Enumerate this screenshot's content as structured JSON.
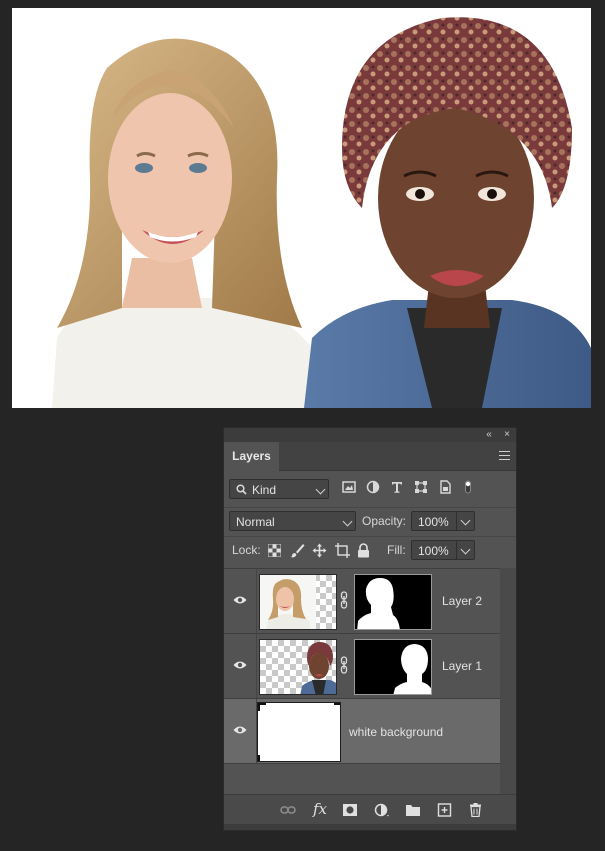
{
  "panel": {
    "collapse_glyph": "«",
    "close_glyph": "×",
    "tab_label": "Layers"
  },
  "filter": {
    "kind_label": "Kind",
    "icons": [
      "search-icon",
      "pixel-layer-filter-icon",
      "adjustment-layer-filter-icon",
      "type-layer-filter-icon",
      "shape-layer-filter-icon",
      "smart-object-filter-icon",
      "filter-toggle-icon"
    ]
  },
  "blend": {
    "mode": "Normal",
    "opacity_label": "Opacity:",
    "opacity_value": "100%"
  },
  "lock": {
    "label": "Lock:",
    "fill_label": "Fill:",
    "fill_value": "100%",
    "icons": [
      "lock-transparent-pixels-icon",
      "lock-image-pixels-icon",
      "lock-position-icon",
      "lock-artboard-icon",
      "lock-all-icon"
    ]
  },
  "layers": [
    {
      "name": "Layer 2",
      "visible": true,
      "selected": false
    },
    {
      "name": "Layer 1",
      "visible": true,
      "selected": false
    },
    {
      "name": "white background",
      "visible": true,
      "selected": true
    }
  ],
  "bottom_icons": [
    "link-layers-icon",
    "fx-icon",
    "layer-mask-icon",
    "adjustment-layer-icon",
    "group-folder-icon",
    "new-layer-icon",
    "trash-icon"
  ],
  "bottom_fx_label": "fx",
  "colors": {
    "panel_bg": "#535353",
    "app_bg": "#252525",
    "selected_row": "#6a6a6a",
    "canvas_bg": "#ffffff"
  }
}
